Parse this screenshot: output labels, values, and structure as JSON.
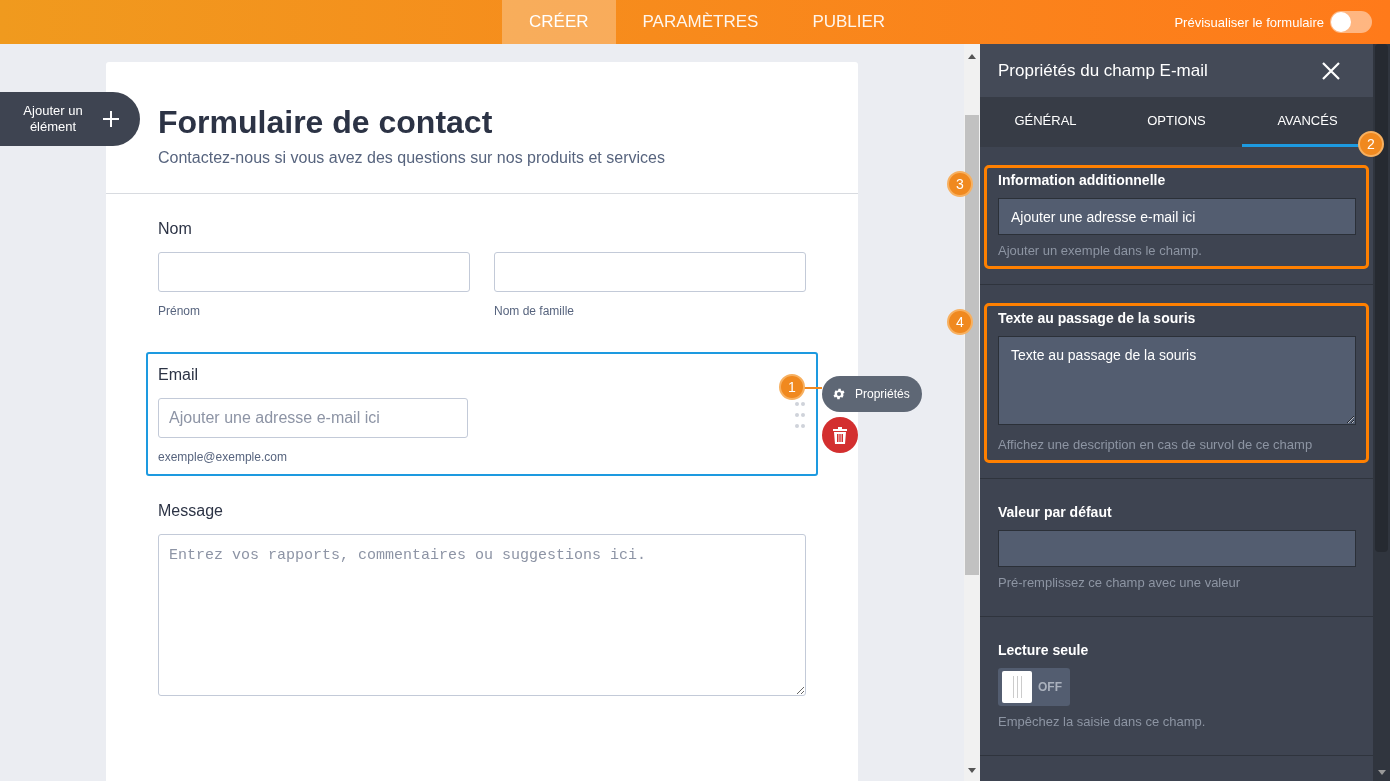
{
  "nav": {
    "tabs": [
      {
        "label": "CRÉER",
        "selected": true
      },
      {
        "label": "PARAMÈTRES",
        "selected": false
      },
      {
        "label": "PUBLIER",
        "selected": false
      }
    ],
    "preview": {
      "label": "Prévisualiser le formulaire",
      "on": false
    }
  },
  "add_element": {
    "label": "Ajouter un élément"
  },
  "form": {
    "title": "Formulaire de contact",
    "subtitle": "Contactez-nous si vous avez des questions sur nos produits et services",
    "fields": [
      {
        "kind": "name",
        "label": "Nom",
        "selected": false,
        "sublabels": [
          "Prénom",
          "Nom de famille"
        ]
      },
      {
        "kind": "email",
        "label": "Email",
        "selected": true,
        "placeholder": "Ajouter une adresse e-mail ici",
        "sublabel": "exemple@exemple.com"
      },
      {
        "kind": "textarea",
        "label": "Message",
        "selected": false,
        "placeholder": "Entrez vos rapports, commentaires ou suggestions ici."
      }
    ]
  },
  "field_toolbar": {
    "properties_label": "Propriétés",
    "callout": "1"
  },
  "panel": {
    "title": "Propriétés du champ E-mail",
    "tabs": [
      {
        "label": "GÉNÉRAL",
        "selected": false
      },
      {
        "label": "OPTIONS",
        "selected": false
      },
      {
        "label": "AVANCÉS",
        "selected": true,
        "callout": "2"
      }
    ],
    "sections": [
      {
        "kind": "text",
        "label": "Information additionnelle",
        "value": "Ajouter une adresse e-mail ici",
        "hint": "Ajouter un exemple dans le champ.",
        "highlighted": true,
        "callout": "3"
      },
      {
        "kind": "textarea",
        "label": "Texte au passage de la souris",
        "value": "Texte au passage de la souris",
        "hint": "Affichez une description en cas de survol de ce champ",
        "highlighted": true,
        "callout": "4"
      },
      {
        "kind": "text",
        "label": "Valeur par défaut",
        "hint": "Pré-remplissez ce champ avec une valeur",
        "highlighted": false
      },
      {
        "kind": "toggle",
        "label": "Lecture seule",
        "on": false,
        "state_label": "OFF",
        "hint": "Empêchez la saisie dans ce champ.",
        "highlighted": false
      }
    ]
  }
}
